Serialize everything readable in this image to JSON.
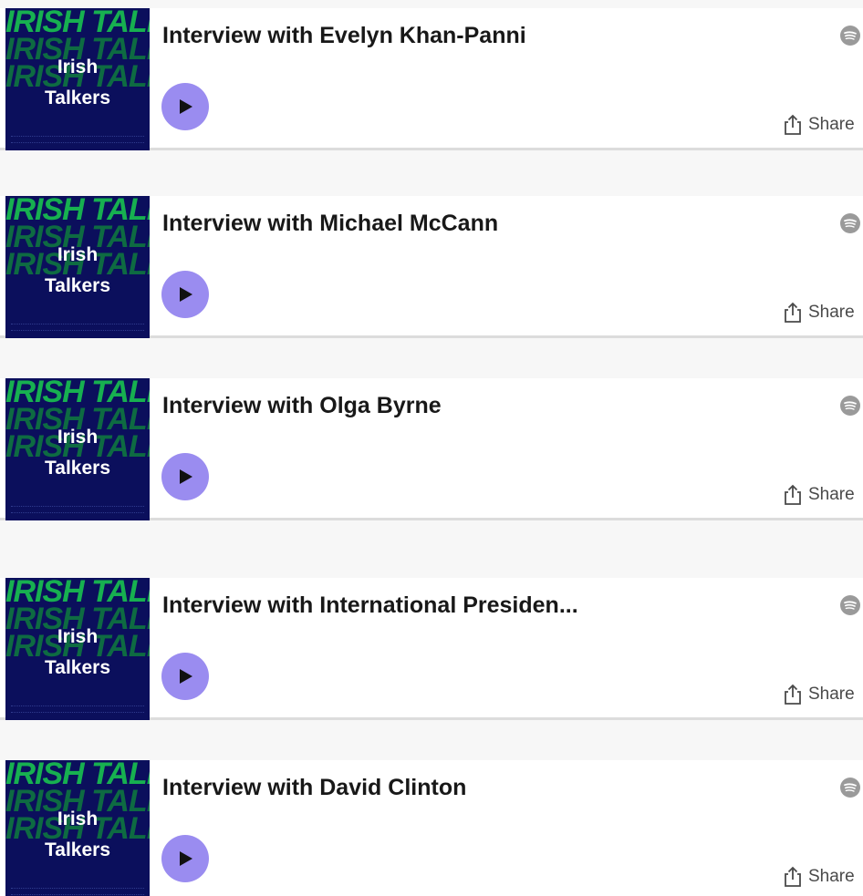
{
  "podcast": {
    "cover_title_line1": "Irish",
    "cover_title_line2": "Talkers",
    "cover_background_text": "IRISH TALKERS",
    "cover_bg_color": "#0b0f5c",
    "cover_accent_color": "#19c24f"
  },
  "player": {
    "play_button_color": "#9a8cf0",
    "share_label": "Share",
    "share_icon": "share-icon",
    "spotify_icon": "spotify-icon"
  },
  "episodes": [
    {
      "title": "Interview with Evelyn Khan-Panni"
    },
    {
      "title": "Interview with Michael McCann"
    },
    {
      "title": "Interview with Olga Byrne"
    },
    {
      "title": "Interview with International Presiden..."
    },
    {
      "title": "Interview with David Clinton"
    }
  ]
}
